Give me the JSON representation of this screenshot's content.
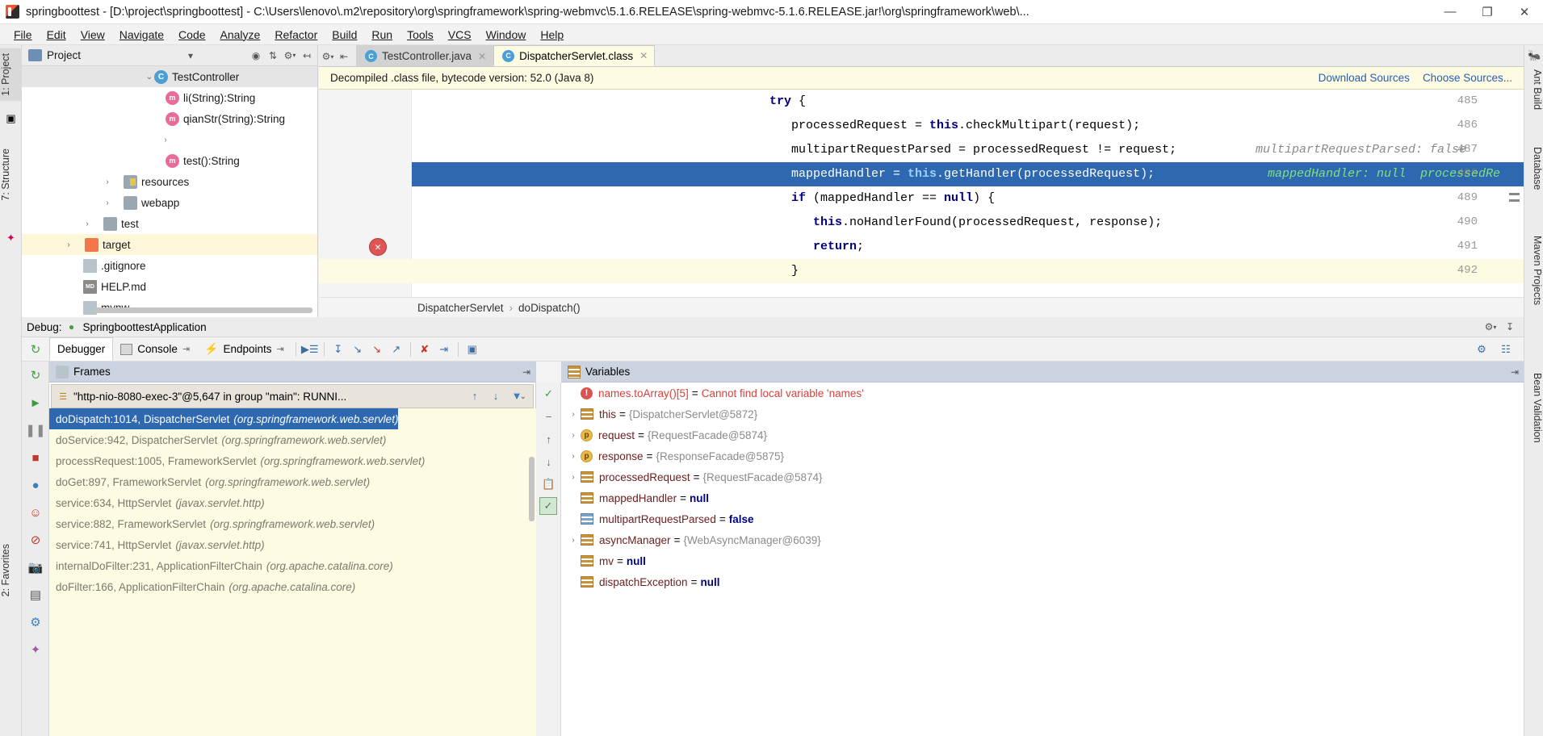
{
  "window": {
    "title": "springboottest - [D:\\project\\springboottest] - C:\\Users\\lenovo\\.m2\\repository\\org\\springframework\\spring-webmvc\\5.1.6.RELEASE\\spring-webmvc-5.1.6.RELEASE.jar!\\org\\springframework\\web\\...",
    "minimize": "—",
    "maximize": "❐",
    "close": "✕"
  },
  "menubar": [
    {
      "label": "File"
    },
    {
      "label": "Edit"
    },
    {
      "label": "View"
    },
    {
      "label": "Navigate"
    },
    {
      "label": "Code"
    },
    {
      "label": "Analyze"
    },
    {
      "label": "Refactor"
    },
    {
      "label": "Build"
    },
    {
      "label": "Run"
    },
    {
      "label": "Tools"
    },
    {
      "label": "VCS"
    },
    {
      "label": "Window"
    },
    {
      "label": "Help"
    }
  ],
  "left_strip": [
    {
      "label": "1: Project"
    },
    {
      "label": "7: Structure"
    },
    {
      "label": "2: Favorites"
    }
  ],
  "right_strip": [
    {
      "label": "Ant Build"
    },
    {
      "label": "Database"
    },
    {
      "label": "Maven Projects"
    },
    {
      "label": "Bean Validation"
    }
  ],
  "project_panel": {
    "title": "Project",
    "header_icons": [
      "collapse-all-icon",
      "expand-icon",
      "settings-icon",
      "hide-icon"
    ],
    "tree": [
      {
        "label": "TestController",
        "kind": "class",
        "arrow": "⌄",
        "indent": 4,
        "state": "selected-gray"
      },
      {
        "label": "li(String):String",
        "kind": "method",
        "arrow": "",
        "indent": 6,
        "state": ""
      },
      {
        "label": "qianStr(String):String",
        "kind": "method",
        "arrow": "",
        "indent": 6,
        "state": ""
      },
      {
        "label": "",
        "kind": "none",
        "arrow": "›",
        "indent": 5,
        "state": ""
      },
      {
        "label": "test():String",
        "kind": "method",
        "arrow": "",
        "indent": 6,
        "state": ""
      },
      {
        "label": "resources",
        "kind": "folder-res",
        "arrow": "›",
        "indent": 3,
        "state": ""
      },
      {
        "label": "webapp",
        "kind": "folder",
        "arrow": "›",
        "indent": 3,
        "state": ""
      },
      {
        "label": "test",
        "kind": "folder",
        "arrow": "›",
        "indent": 2,
        "state": ""
      },
      {
        "label": "target",
        "kind": "folder-orange",
        "arrow": "›",
        "indent": 1,
        "state": "selected-yellow"
      },
      {
        "label": ".gitignore",
        "kind": "file",
        "arrow": "",
        "indent": 2,
        "state": ""
      },
      {
        "label": "HELP.md",
        "kind": "md",
        "arrow": "",
        "indent": 2,
        "state": ""
      },
      {
        "label": "mvnw",
        "kind": "file",
        "arrow": "",
        "indent": 2,
        "state": ""
      }
    ]
  },
  "editor": {
    "tabs": [
      {
        "label": "TestController.java",
        "icon": "java-class-icon",
        "active": false,
        "close": "✕"
      },
      {
        "label": "DispatcherServlet.class",
        "icon": "compiled-class-icon",
        "active": true,
        "close": "✕"
      }
    ],
    "notification": {
      "text": "Decompiled .class file, bytecode version: 52.0 (Java 8)",
      "links": [
        {
          "label": "Download Sources"
        },
        {
          "label": "Choose Sources..."
        }
      ]
    },
    "lines": [
      {
        "num": "485",
        "indent": 8,
        "code": "try {",
        "kw": "try",
        "hint": "",
        "marker": "",
        "state": ""
      },
      {
        "num": "486",
        "indent": 11,
        "code": "processedRequest = this.checkMultipart(request);",
        "kw": "this",
        "hint": "",
        "marker": "",
        "state": ""
      },
      {
        "num": "487",
        "indent": 11,
        "code": "multipartRequestParsed = processedRequest != request;",
        "kw": "",
        "hint": "multipartRequestParsed: false",
        "marker": "",
        "state": ""
      },
      {
        "num": "488",
        "indent": 11,
        "code": "mappedHandler = this.getHandler(processedRequest);",
        "kw": "this",
        "hint": "mappedHandler: null  processedRe",
        "marker": "breakpoint",
        "state": "execution"
      },
      {
        "num": "489",
        "indent": 11,
        "code": "if (mappedHandler == null) {",
        "kw": "if null",
        "hint": "",
        "marker": "",
        "state": ""
      },
      {
        "num": "490",
        "indent": 14,
        "code": "this.noHandlerFound(processedRequest, response);",
        "kw": "this",
        "hint": "",
        "marker": "",
        "state": ""
      },
      {
        "num": "491",
        "indent": 14,
        "code": "return;",
        "kw": "return",
        "hint": "",
        "marker": "",
        "state": ""
      },
      {
        "num": "492",
        "indent": 11,
        "code": "}",
        "kw": "",
        "hint": "",
        "marker": "bulb",
        "state": "caret-row"
      }
    ],
    "breadcrumb": [
      "DispatcherServlet",
      "doDispatch()"
    ],
    "breadcrumb_sep": "›"
  },
  "debug": {
    "header": {
      "label": "Debug:",
      "config_name": "SpringboottestApplication",
      "settings_icon": "gear-icon",
      "hide_icon": "hide-icon"
    },
    "tabs": [
      {
        "label": "Debugger",
        "icon": "debugger-icon",
        "active": true
      },
      {
        "label": "Console",
        "icon": "console-icon",
        "active": false,
        "pin": "⇥"
      },
      {
        "label": "Endpoints",
        "icon": "endpoints-icon",
        "active": false,
        "pin": "⇥"
      }
    ],
    "toolbar_icons": [
      "show-execution-point-icon",
      "step-over-icon",
      "step-into-icon",
      "force-step-into-icon",
      "step-out-icon",
      "drop-frame-icon",
      "run-to-cursor-icon",
      "evaluate-expression-icon"
    ],
    "right_icons": [
      "settings-icon",
      "layout-icon"
    ],
    "side_icons": [
      "rerun-icon",
      "resume-icon",
      "pause-icon",
      "stop-icon",
      "view-breakpoints-icon",
      "mute-breakpoints-icon",
      "disable-icon",
      "camera-icon",
      "layout-icon",
      "settings-gear-icon",
      "pin-icon"
    ],
    "frames": {
      "title": "Frames",
      "icon": "frames-icon",
      "hide_icon": "⇥",
      "thread": "\"http-nio-8080-exec-3\"@5,647 in group \"main\": RUNNI...",
      "thread_chevron": "⌄",
      "toolbar_icons": [
        "up-icon",
        "down-icon",
        "filter-icon"
      ],
      "side_tools": [
        "customize-icon",
        "minus-icon",
        "up-arrow-icon",
        "down-arrow-icon",
        "copy-icon",
        "checked-box-icon"
      ],
      "list": [
        {
          "method": "doDispatch:1014, DispatcherServlet",
          "pkg": "(org.springframework.web.servlet)",
          "selected": true
        },
        {
          "method": "doService:942, DispatcherServlet",
          "pkg": "(org.springframework.web.servlet)",
          "selected": false
        },
        {
          "method": "processRequest:1005, FrameworkServlet",
          "pkg": "(org.springframework.web.servlet)",
          "selected": false
        },
        {
          "method": "doGet:897, FrameworkServlet",
          "pkg": "(org.springframework.web.servlet)",
          "selected": false
        },
        {
          "method": "service:634, HttpServlet",
          "pkg": "(javax.servlet.http)",
          "selected": false
        },
        {
          "method": "service:882, FrameworkServlet",
          "pkg": "(org.springframework.web.servlet)",
          "selected": false
        },
        {
          "method": "service:741, HttpServlet",
          "pkg": "(javax.servlet.http)",
          "selected": false
        },
        {
          "method": "internalDoFilter:231, ApplicationFilterChain",
          "pkg": "(org.apache.catalina.core)",
          "selected": false
        },
        {
          "method": "doFilter:166, ApplicationFilterChain",
          "pkg": "(org.apache.catalina.core)",
          "selected": false
        }
      ]
    },
    "variables": {
      "title": "Variables",
      "icon": "variables-icon",
      "hide_icon": "⇥",
      "list": [
        {
          "arrow": "",
          "icon": "error",
          "name": "names.toArray()[5]",
          "value": "Cannot find local variable 'names'",
          "value_kind": "red",
          "name_kind": "err"
        },
        {
          "arrow": "›",
          "icon": "obj",
          "name": "this",
          "value": "{DispatcherServlet@5872}",
          "value_kind": "gray",
          "name_kind": ""
        },
        {
          "arrow": "›",
          "icon": "param",
          "icon_char": "p",
          "name": "request",
          "value": "{RequestFacade@5874}",
          "value_kind": "gray",
          "name_kind": ""
        },
        {
          "arrow": "›",
          "icon": "param",
          "icon_char": "p",
          "name": "response",
          "value": "{ResponseFacade@5875}",
          "value_kind": "gray",
          "name_kind": ""
        },
        {
          "arrow": "›",
          "icon": "obj",
          "name": "processedRequest",
          "value": "{RequestFacade@5874}",
          "value_kind": "gray",
          "name_kind": ""
        },
        {
          "arrow": "",
          "icon": "obj",
          "name": "mappedHandler",
          "value": "null",
          "value_kind": "null",
          "name_kind": ""
        },
        {
          "arrow": "",
          "icon": "prim",
          "name": "multipartRequestParsed",
          "value": "false",
          "value_kind": "bool",
          "name_kind": ""
        },
        {
          "arrow": "›",
          "icon": "obj",
          "name": "asyncManager",
          "value": "{WebAsyncManager@6039}",
          "value_kind": "gray",
          "name_kind": ""
        },
        {
          "arrow": "",
          "icon": "obj",
          "name": "mv",
          "value": "null",
          "value_kind": "null",
          "name_kind": ""
        },
        {
          "arrow": "",
          "icon": "obj",
          "name": "dispatchException",
          "value": "null",
          "value_kind": "null",
          "name_kind": ""
        }
      ]
    }
  }
}
